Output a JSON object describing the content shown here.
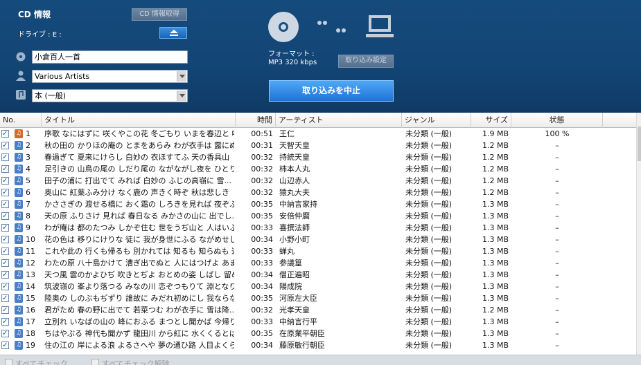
{
  "header": {
    "title": "CD 情報",
    "get_info_label": "CD 情報取得",
    "drive_label": "ドライブ : E :",
    "album": "小倉百人一首",
    "artist": "Various Artists",
    "genre": "本 (一般)",
    "format_label": "フォーマット :",
    "format_value": "MP3 320 kbps",
    "settings_label": "取り込み設定",
    "stop_label": "取り込みを中止"
  },
  "columns": {
    "no": "No.",
    "title": "タイトル",
    "time": "時間",
    "artist": "アーティスト",
    "genre": "ジャンル",
    "size": "サイズ",
    "status": "状態"
  },
  "tracks": [
    {
      "no": "1",
      "title": "序歌 なにはずに 咲くやこの花 冬ごもり いまを春辺と 咲...",
      "time": "00:51",
      "artist": "王仁",
      "genre": "未分類 (一般)",
      "size": "1.9 MB",
      "status": "100 %"
    },
    {
      "no": "2",
      "title": "秋の田の かりほの庵の とまをあらみ わが衣手は 露にぬ...",
      "time": "00:31",
      "artist": "天智天皇",
      "genre": "未分類 (一般)",
      "size": "1.2 MB",
      "status": "–"
    },
    {
      "no": "3",
      "title": "春過ぎて 夏来にけらし 白妙の 衣ほすてふ 天の香具山",
      "time": "00:32",
      "artist": "持統天皇",
      "genre": "未分類 (一般)",
      "size": "1.2 MB",
      "status": "–"
    },
    {
      "no": "4",
      "title": "足引きの 山鳥の尾の しだり尾の ながながし夜を ひとり...",
      "time": "00:32",
      "artist": "柿本人丸",
      "genre": "未分類 (一般)",
      "size": "1.2 MB",
      "status": "–"
    },
    {
      "no": "5",
      "title": "田子の浦に 打出でて みれば 白妙の ふじの高嶺に 雪...",
      "time": "00:32",
      "artist": "山辺赤人",
      "genre": "未分類 (一般)",
      "size": "1.2 MB",
      "status": "–"
    },
    {
      "no": "6",
      "title": "奥山に 紅葉ふみ分け なく鹿の 声きく時ぞ 秋は悲しき",
      "time": "00:32",
      "artist": "猿丸大夫",
      "genre": "未分類 (一般)",
      "size": "1.2 MB",
      "status": "–"
    },
    {
      "no": "7",
      "title": "かささぎの 渡せる橋に おく霜の しろきを見れば 夜ぞふ...",
      "time": "00:35",
      "artist": "中納言家持",
      "genre": "未分類 (一般)",
      "size": "1.3 MB",
      "status": "–"
    },
    {
      "no": "8",
      "title": "天の原 ふりさけ 見れば 春日なる みかさの山に 出でし...",
      "time": "00:35",
      "artist": "安倍仲麿",
      "genre": "未分類 (一般)",
      "size": "1.3 MB",
      "status": "–"
    },
    {
      "no": "9",
      "title": "わが庵は 都のたつみ しかぞ住む 世をうぢ山と 人はいふ...",
      "time": "00:33",
      "artist": "喜撰法師",
      "genre": "未分類 (一般)",
      "size": "1.3 MB",
      "status": "–"
    },
    {
      "no": "10",
      "title": "花の色は 移りにけりな 徒に 我が身世にふる ながめせし...",
      "time": "00:34",
      "artist": "小野小町",
      "genre": "未分類 (一般)",
      "size": "1.3 MB",
      "status": "–"
    },
    {
      "no": "11",
      "title": "これや此の 行くも帰るも 別かれては 知るも 知らぬも 逢...",
      "time": "00:33",
      "artist": "蝉丸",
      "genre": "未分類 (一般)",
      "size": "1.3 MB",
      "status": "–"
    },
    {
      "no": "12",
      "title": "わたの原 八十島かけて 漕ぎ出でぬと 人にはつげよ あま...",
      "time": "00:33",
      "artist": "参議篁",
      "genre": "未分類 (一般)",
      "size": "1.3 MB",
      "status": "–"
    },
    {
      "no": "13",
      "title": "天つ風 雲のかよひぢ 吹きとぢよ おとめの姿 しばし 留め...",
      "time": "00:34",
      "artist": "僧正遍昭",
      "genre": "未分類 (一般)",
      "size": "1.3 MB",
      "status": "–"
    },
    {
      "no": "14",
      "title": "筑波嶺の 峯より落つる みなの川 恋ぞつもりて 淵となり...",
      "time": "00:34",
      "artist": "陽成院",
      "genre": "未分類 (一般)",
      "size": "1.3 MB",
      "status": "–"
    },
    {
      "no": "15",
      "title": "陸奥の しのぶもぢずり 誰故に みだれ初めにし 我ならな...",
      "time": "00:35",
      "artist": "河原左大臣",
      "genre": "未分類 (一般)",
      "size": "1.3 MB",
      "status": "–"
    },
    {
      "no": "16",
      "title": "君がため 春の野に出でて 若菜つむ わが衣手に 雪は降...",
      "time": "00:32",
      "artist": "光孝天皇",
      "genre": "未分類 (一般)",
      "size": "1.2 MB",
      "status": "–"
    },
    {
      "no": "17",
      "title": "立別れ いなばの山の 峰におふる まつとし聞かば 今帰り...",
      "time": "00:33",
      "artist": "中納言行平",
      "genre": "未分類 (一般)",
      "size": "1.3 MB",
      "status": "–"
    },
    {
      "no": "18",
      "title": "ちはやぶる 神代も聞かず 龍田川 から紅に 水くくるとは",
      "time": "00:35",
      "artist": "在原業平朝臣",
      "genre": "未分類 (一般)",
      "size": "1.3 MB",
      "status": "–"
    },
    {
      "no": "19",
      "title": "住の江の 岸による浪 よるさへや 夢の通ひ路 人目よくら...",
      "time": "00:34",
      "artist": "藤原敏行朝臣",
      "genre": "未分類 (一般)",
      "size": "1.3 MB",
      "status": "–"
    }
  ],
  "footer": {
    "check_all": "すべてチェック",
    "uncheck_all": "すべてチェック解除"
  }
}
